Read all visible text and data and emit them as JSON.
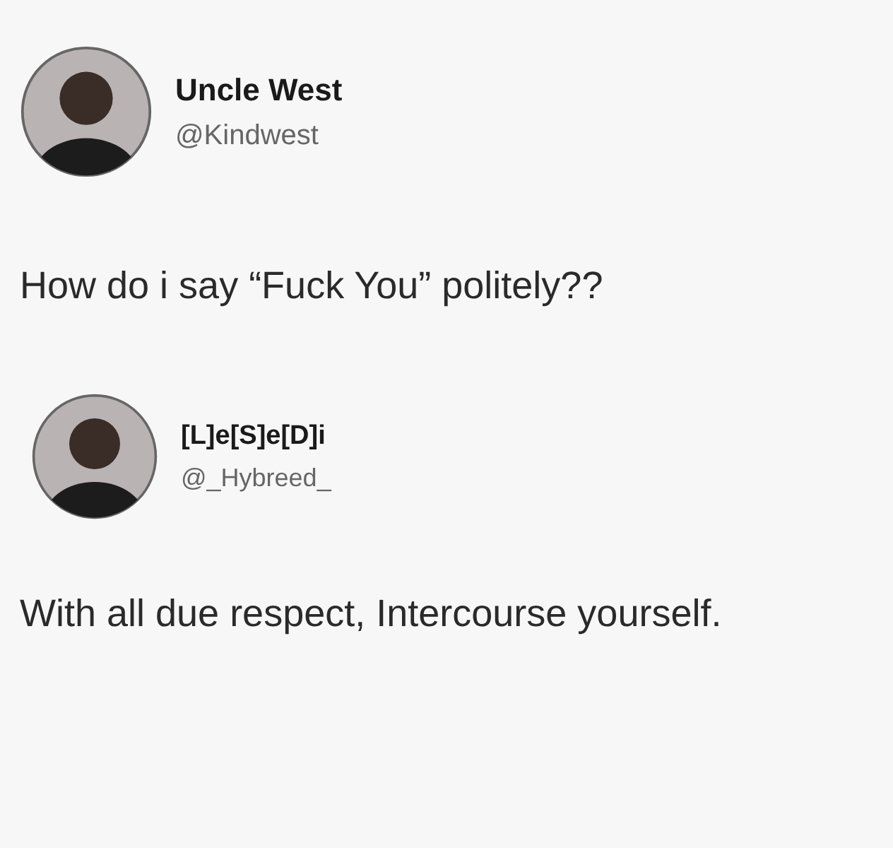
{
  "posts": [
    {
      "author": {
        "name": "Uncle West",
        "handle": "@Kindwest"
      },
      "text": "How do i say “Fuck You” politely??"
    },
    {
      "author": {
        "name": "[L]e[S]e[D]i",
        "handle": "@_Hybreed_"
      },
      "text": "With all due respect, Intercourse yourself."
    }
  ]
}
